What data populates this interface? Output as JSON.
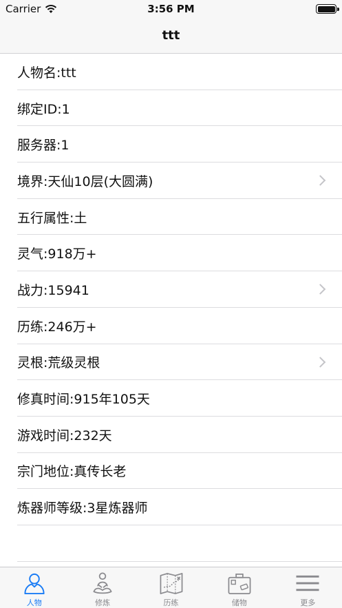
{
  "status_bar": {
    "carrier": "Carrier",
    "time": "3:56 PM"
  },
  "nav": {
    "title": "ttt"
  },
  "rows": [
    {
      "label": "人物名:ttt",
      "chevron": false
    },
    {
      "label": "绑定ID:1",
      "chevron": false
    },
    {
      "label": "服务器:1",
      "chevron": false
    },
    {
      "label": "境界:天仙10层(大圆满)",
      "chevron": true
    },
    {
      "label": "五行属性:土",
      "chevron": false
    },
    {
      "label": "灵气:918万+",
      "chevron": false
    },
    {
      "label": "战力:15941",
      "chevron": true
    },
    {
      "label": "历练:246万+",
      "chevron": false
    },
    {
      "label": "灵根:荒级灵根",
      "chevron": true
    },
    {
      "label": "修真时间:915年105天",
      "chevron": false
    },
    {
      "label": "游戏时间:232天",
      "chevron": false
    },
    {
      "label": "宗门地位:真传长老",
      "chevron": false
    },
    {
      "label": "炼器师等级:3星炼器师",
      "chevron": false
    }
  ],
  "tabs": [
    {
      "label": "人物",
      "icon": "person-icon",
      "active": true
    },
    {
      "label": "修炼",
      "icon": "meditation-icon",
      "active": false
    },
    {
      "label": "历练",
      "icon": "map-icon",
      "active": false
    },
    {
      "label": "储物",
      "icon": "storage-bag-icon",
      "active": false
    },
    {
      "label": "更多",
      "icon": "menu-icon",
      "active": false
    }
  ],
  "colors": {
    "accent": "#1a7cf5",
    "inactive": "#8a8a8e",
    "bar_background": "#f7f7f7"
  }
}
